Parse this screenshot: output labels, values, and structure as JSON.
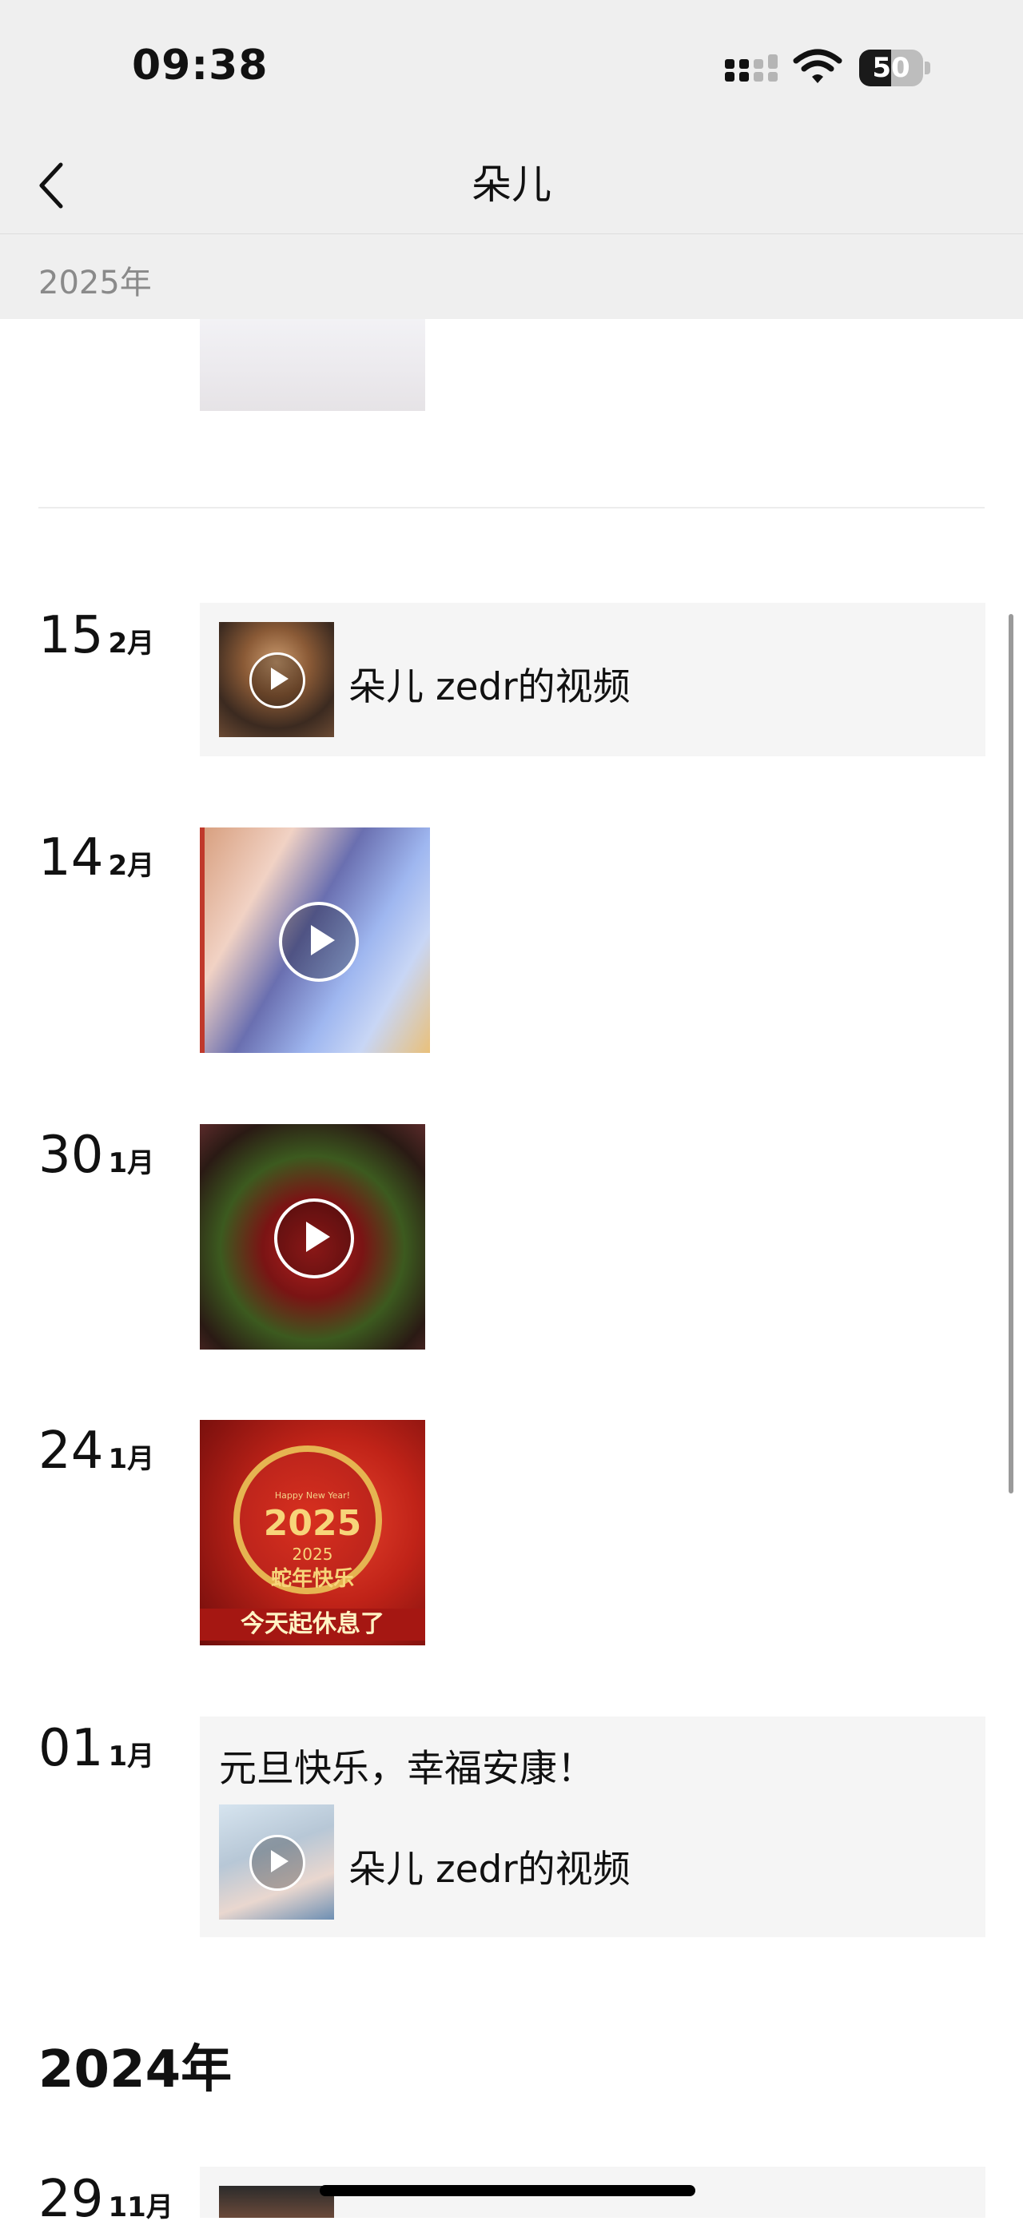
{
  "status_bar": {
    "time": "09:38",
    "battery_level": "50"
  },
  "nav": {
    "title": "朵儿"
  },
  "sticky_year": "2025年",
  "posts": [
    {
      "day": "15",
      "month": "2月",
      "type": "shared-video",
      "share_title": "朵儿 zedr的视频"
    },
    {
      "day": "14",
      "month": "2月",
      "type": "video"
    },
    {
      "day": "30",
      "month": "1月",
      "type": "video"
    },
    {
      "day": "24",
      "month": "1月",
      "type": "image",
      "image_text": {
        "greeting": "Happy New Year!",
        "year_big": "2025",
        "year_small": "2025",
        "line": "蛇年快乐",
        "banner": "今天起休息了"
      }
    },
    {
      "day": "01",
      "month": "1月",
      "type": "text-with-video",
      "text": "元旦快乐，幸福安康！",
      "share_title": "朵儿 zedr的视频"
    }
  ],
  "year_heading": "2024年",
  "last_post": {
    "day": "29",
    "month": "11月"
  },
  "icons": {
    "back": "chevron-left-icon",
    "play": "play-icon",
    "signal": "cellular-signal-icon",
    "wifi": "wifi-icon",
    "battery": "battery-icon"
  }
}
